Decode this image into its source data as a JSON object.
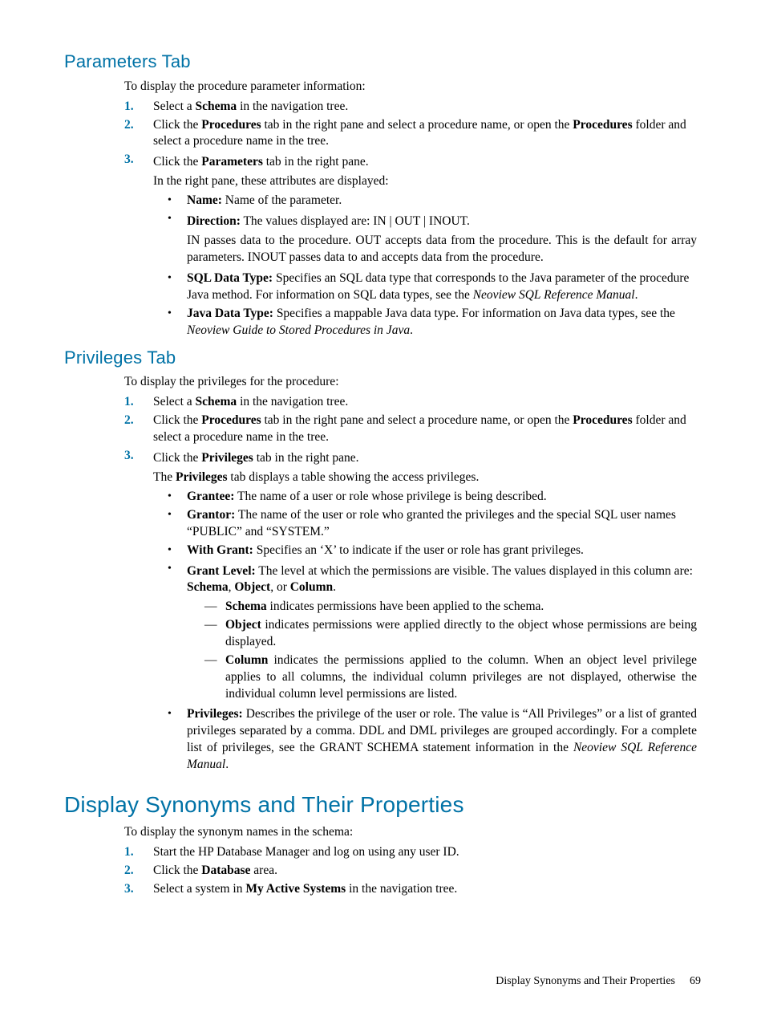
{
  "sections": {
    "parameters": {
      "heading": "Parameters Tab",
      "intro": "To display the procedure parameter information:",
      "steps": {
        "s1_pre": "Select a ",
        "s1_b": "Schema",
        "s1_post": "  in the navigation tree.",
        "s2_pre": "Click the ",
        "s2_b1": "Procedures",
        "s2_mid": " tab in the right pane and select a procedure name, or open the ",
        "s2_b2": "Procedures",
        "s2_post": " folder and select a procedure name in the tree.",
        "s3_pre": "Click the ",
        "s3_b": "Parameters",
        "s3_post": " tab in the right pane.",
        "s3_para": "In the right pane, these attributes are displayed:"
      },
      "attrs": {
        "name_b": "Name:",
        "name_t": " Name of the parameter.",
        "dir_b": "Direction:",
        "dir_t": " The values displayed are: IN | OUT | INOUT.",
        "dir_p": "IN passes data to the procedure. OUT accepts data from the procedure. This is the default for array parameters. INOUT passes data to and accepts data from the procedure.",
        "sql_b": "SQL Data Type:",
        "sql_t1": " Specifies an SQL data type that corresponds to the Java parameter of the procedure Java method. For information on SQL data types, see the ",
        "sql_i": "Neoview SQL Reference Manual",
        "sql_t2": ".",
        "java_b": "Java Data Type:",
        "java_t1": " Specifies a mappable Java data type. For information on Java data types, see the ",
        "java_i": "Neoview Guide to Stored Procedures in Java",
        "java_t2": "."
      }
    },
    "privileges": {
      "heading": "Privileges Tab",
      "intro": "To display the privileges for the procedure:",
      "steps": {
        "s1_pre": "Select a ",
        "s1_b": "Schema",
        "s1_post": " in the navigation tree.",
        "s2_pre": "Click the ",
        "s2_b1": "Procedures",
        "s2_mid": " tab in the right pane and select a procedure name, or open the ",
        "s2_b2": "Procedures",
        "s2_post": " folder and select a procedure name in the tree.",
        "s3_pre": "Click the ",
        "s3_b": "Privileges",
        "s3_post": " tab in the right pane.",
        "s3_para_pre": "The ",
        "s3_para_b": "Privileges",
        "s3_para_post": " tab displays a table showing the access privileges."
      },
      "attrs": {
        "grantee_b": "Grantee:",
        "grantee_t": " The name of a user or role whose privilege is being described.",
        "grantor_b": "Grantor:",
        "grantor_t": " The name of the user or role who granted the privileges and the special SQL user names “PUBLIC” and “SYSTEM.”",
        "withgrant_b": "With Grant:",
        "withgrant_t": " Specifies an ‘X’ to indicate if the user or role has grant privileges.",
        "grantlevel_b": "Grant Level:",
        "grantlevel_t1": " The level at which the permissions are visible. The values displayed in this column are: ",
        "grantlevel_b1": "Schema",
        "grantlevel_s1": ", ",
        "grantlevel_b2": "Object",
        "grantlevel_s2": ", or ",
        "grantlevel_b3": "Column",
        "grantlevel_t2": ".",
        "dash_schema_b": "Schema",
        "dash_schema_t": " indicates permissions have been applied to the schema.",
        "dash_object_b": "Object",
        "dash_object_t": " indicates permissions were applied directly to the object whose permissions are being displayed.",
        "dash_column_b": "Column",
        "dash_column_t": " indicates the permissions applied to the column. When an object level privilege applies to all columns, the individual column privileges are not displayed, otherwise the individual column level permissions are listed.",
        "privs_b": "Privileges:",
        "privs_t1": " Describes the privilege of the user or role. The value is “All Privileges” or a list of granted privileges separated by a comma. DDL and DML privileges are grouped accordingly. For a complete list of privileges, see the GRANT SCHEMA statement information in the ",
        "privs_i": "Neoview SQL Reference Manual",
        "privs_t2": "."
      }
    },
    "synonyms": {
      "heading": "Display Synonyms and Their Properties",
      "intro": "To display the synonym names in the schema:",
      "steps": {
        "s1": "Start the HP Database Manager and log on using any user ID.",
        "s2_pre": "Click the ",
        "s2_b": "Database",
        "s2_post": " area.",
        "s3_pre": "Select a system in ",
        "s3_b": "My Active Systems",
        "s3_post": " in the navigation tree."
      }
    }
  },
  "footer": {
    "section": "Display Synonyms and Their Properties",
    "page": "69"
  },
  "nums": {
    "n1": "1.",
    "n2": "2.",
    "n3": "3."
  },
  "glyphs": {
    "bullet": "•",
    "dash": "—"
  }
}
